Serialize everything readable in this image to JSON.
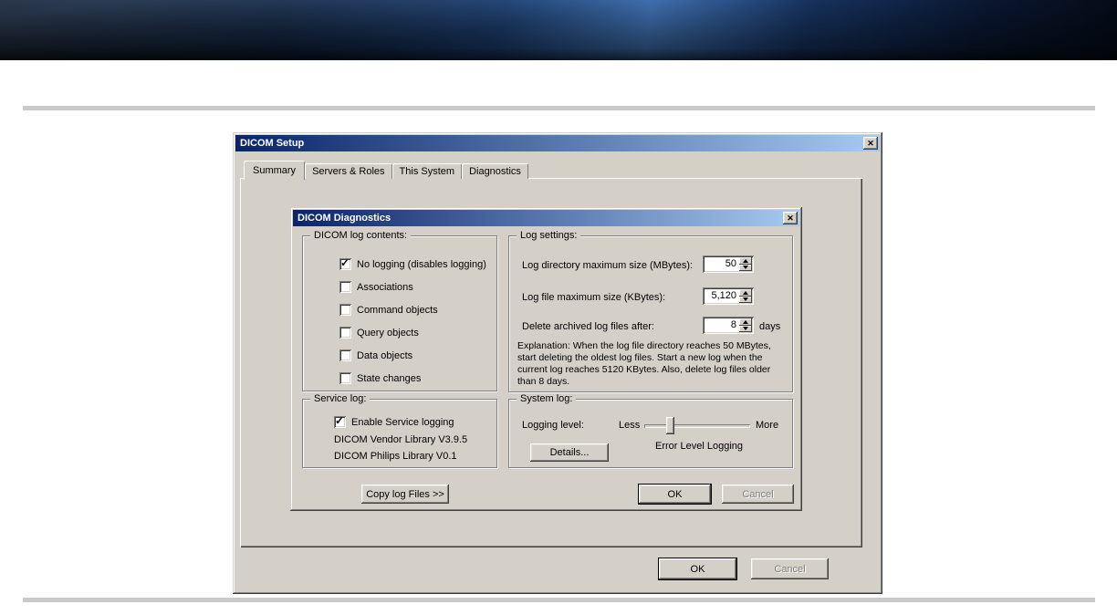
{
  "icons": {
    "close": "✕"
  },
  "colors": {
    "titlebar_start": "#0a246a",
    "titlebar_end": "#a6caf0",
    "dialog_face": "#d4d0c8"
  },
  "setup_dialog": {
    "title": "DICOM Setup",
    "tabs": [
      "Summary",
      "Servers & Roles",
      "This System",
      "Diagnostics"
    ],
    "buttons": {
      "ok": "OK",
      "cancel": "Cancel"
    }
  },
  "diagnostics_dialog": {
    "title": "DICOM Diagnostics",
    "log_contents": {
      "legend": "DICOM log contents:",
      "options": [
        {
          "label": "No logging (disables logging)",
          "checked": true
        },
        {
          "label": "Associations",
          "checked": false
        },
        {
          "label": "Command objects",
          "checked": false
        },
        {
          "label": "Query objects",
          "checked": false
        },
        {
          "label": "Data objects",
          "checked": false
        },
        {
          "label": "State changes",
          "checked": false
        }
      ]
    },
    "service_log": {
      "legend": "Service log:",
      "enable_option": {
        "label": "Enable Service logging",
        "checked": true
      },
      "library_lines": [
        "DICOM Vendor Library V3.9.5",
        "DICOM Philips Library V0.1"
      ]
    },
    "copy_log_button": "Copy log Files >>",
    "log_settings": {
      "legend": "Log settings:",
      "rows": [
        {
          "label": "Log directory maximum size (MBytes):",
          "value": "50"
        },
        {
          "label": "Log file maximum size (KBytes):",
          "value": "5,120"
        },
        {
          "label": "Delete archived log files after:",
          "value": "8",
          "suffix": "days"
        }
      ],
      "explanation": "Explanation: When the log file directory reaches 50 MBytes, start deleting the oldest log files. Start a new log when the current log reaches 5120 KBytes. Also, delete log files older than 8 days."
    },
    "system_log": {
      "legend": "System log:",
      "logging_level_label": "Logging level:",
      "less": "Less",
      "more": "More",
      "details_button": "Details...",
      "level_text": "Error Level Logging"
    },
    "buttons": {
      "ok": "OK",
      "cancel": "Cancel"
    }
  }
}
